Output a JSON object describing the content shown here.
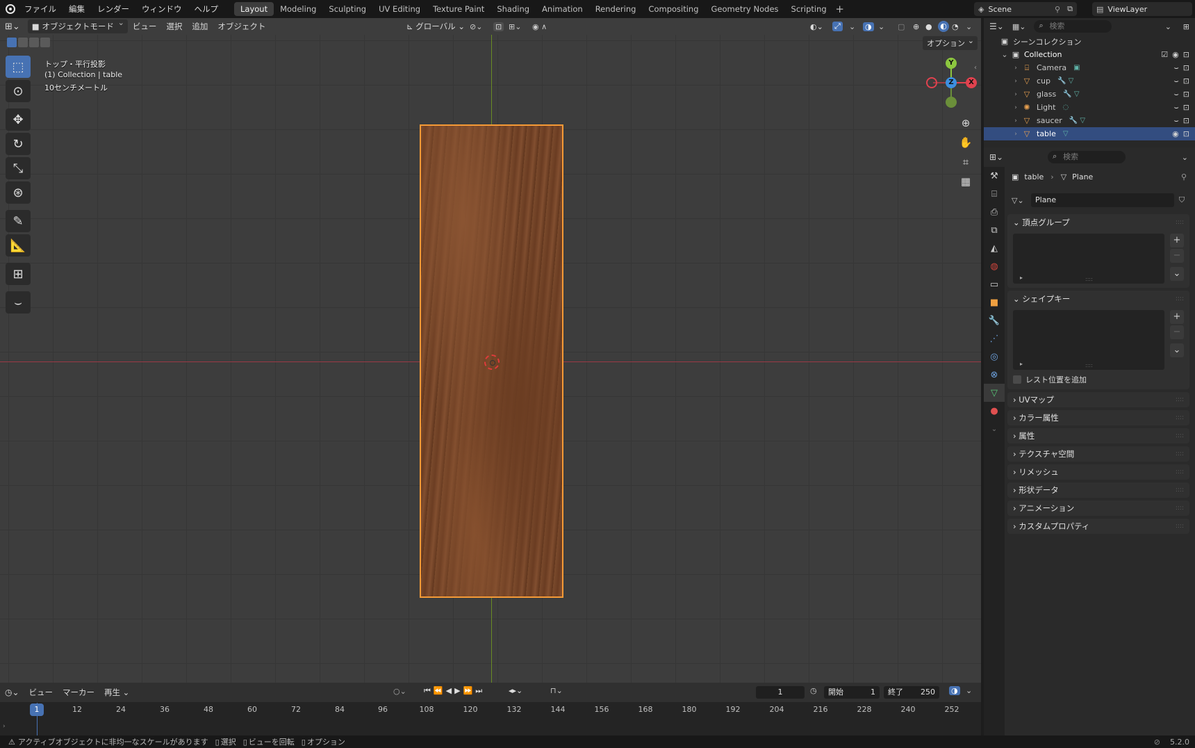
{
  "topbar": {
    "menus": [
      "ファイル",
      "編集",
      "レンダー",
      "ウィンドウ",
      "ヘルプ"
    ],
    "workspaces": [
      "Layout",
      "Modeling",
      "Sculpting",
      "UV Editing",
      "Texture Paint",
      "Shading",
      "Animation",
      "Rendering",
      "Compositing",
      "Geometry Nodes",
      "Scripting"
    ],
    "active_workspace": "Layout",
    "scene": "Scene",
    "view_layer": "ViewLayer"
  },
  "viewport": {
    "mode": "オブジェクトモード",
    "menus": [
      "ビュー",
      "選択",
      "追加",
      "オブジェクト"
    ],
    "transform_orientation": "グローバル",
    "options_label": "オプション",
    "overlay_view": "トップ・平行投影",
    "overlay_collection": "(1) Collection | table",
    "overlay_scale": "10センチメートル",
    "gizmo": {
      "x": "X",
      "y": "Y",
      "z": "Z"
    }
  },
  "timeline": {
    "menus": [
      "ビュー",
      "マーカー",
      "再生"
    ],
    "current_frame": "1",
    "start_label": "開始",
    "start_value": "1",
    "end_label": "終了",
    "end_value": "250",
    "ticks": [
      "12",
      "24",
      "36",
      "48",
      "60",
      "72",
      "84",
      "96",
      "108",
      "120",
      "132",
      "144",
      "156",
      "168",
      "180",
      "192",
      "204",
      "216",
      "228",
      "240",
      "252"
    ],
    "playhead_label": "1"
  },
  "statusbar": {
    "warning": "アクティブオブジェクトに非均一なスケールがあります",
    "hint_select": "選択",
    "hint_rotate": "ビューを回転",
    "hint_options": "オプション",
    "version": "5.2.0"
  },
  "outliner": {
    "search_placeholder": "検索",
    "root": "シーンコレクション",
    "collection": "Collection",
    "items": [
      {
        "name": "Camera",
        "selected": false
      },
      {
        "name": "cup",
        "selected": false
      },
      {
        "name": "glass",
        "selected": false
      },
      {
        "name": "Light",
        "selected": false
      },
      {
        "name": "saucer",
        "selected": false
      },
      {
        "name": "table",
        "selected": true
      }
    ]
  },
  "properties": {
    "search_placeholder": "検索",
    "breadcrumb_object": "table",
    "breadcrumb_data": "Plane",
    "mesh_name": "Plane",
    "panel_vertex_groups": "頂点グループ",
    "panel_shape_keys": "シェイプキー",
    "rest_position_label": "レスト位置を追加",
    "collapsed_panels": [
      "UVマップ",
      "カラー属性",
      "属性",
      "テクスチャ空間",
      "リメッシュ",
      "形状データ",
      "アニメーション",
      "カスタムプロパティ"
    ]
  },
  "colors": {
    "selection_orange": "#f59a36",
    "active_blue": "#4772b3",
    "x_axis": "#e0424e",
    "y_axis": "#8cc63f",
    "z_axis": "#3d8fe0"
  }
}
